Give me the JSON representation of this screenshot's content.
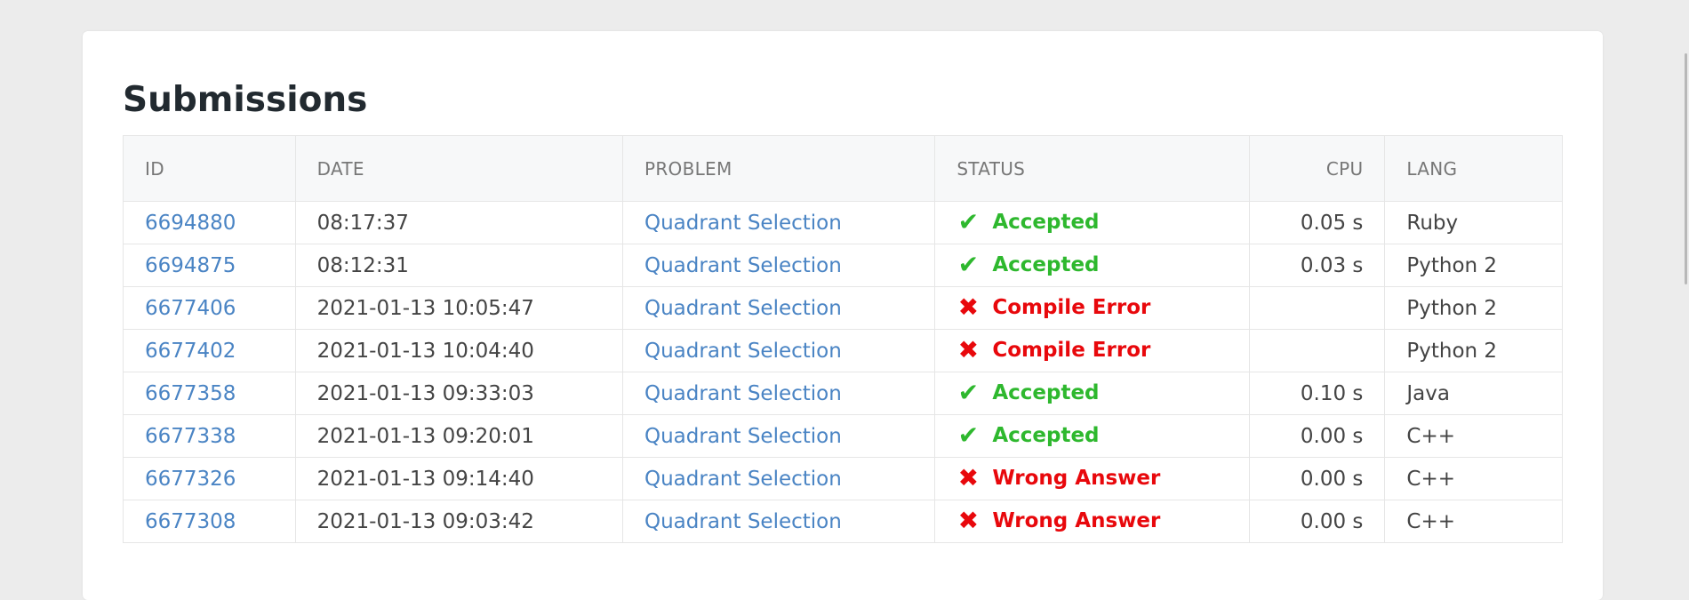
{
  "page": {
    "title": "Submissions"
  },
  "columns": {
    "id": "ID",
    "date": "DATE",
    "problem": "PROBLEM",
    "status": "STATUS",
    "cpu": "CPU",
    "lang": "LANG"
  },
  "colors": {
    "accepted": "#2eb82e",
    "error": "#e8080c",
    "link": "#4a84c4"
  },
  "icons": {
    "accepted": "check-icon",
    "error": "cross-icon"
  },
  "submissions": [
    {
      "id": "6694880",
      "date": "08:17:37",
      "problem": "Quadrant Selection",
      "status": "Accepted",
      "result": "accepted",
      "cpu": "0.05 s",
      "lang": "Ruby"
    },
    {
      "id": "6694875",
      "date": "08:12:31",
      "problem": "Quadrant Selection",
      "status": "Accepted",
      "result": "accepted",
      "cpu": "0.03 s",
      "lang": "Python 2"
    },
    {
      "id": "6677406",
      "date": "2021-01-13 10:05:47",
      "problem": "Quadrant Selection",
      "status": "Compile Error",
      "result": "error",
      "cpu": "",
      "lang": "Python 2"
    },
    {
      "id": "6677402",
      "date": "2021-01-13 10:04:40",
      "problem": "Quadrant Selection",
      "status": "Compile Error",
      "result": "error",
      "cpu": "",
      "lang": "Python 2"
    },
    {
      "id": "6677358",
      "date": "2021-01-13 09:33:03",
      "problem": "Quadrant Selection",
      "status": "Accepted",
      "result": "accepted",
      "cpu": "0.10 s",
      "lang": "Java"
    },
    {
      "id": "6677338",
      "date": "2021-01-13 09:20:01",
      "problem": "Quadrant Selection",
      "status": "Accepted",
      "result": "accepted",
      "cpu": "0.00 s",
      "lang": "C++"
    },
    {
      "id": "6677326",
      "date": "2021-01-13 09:14:40",
      "problem": "Quadrant Selection",
      "status": "Wrong Answer",
      "result": "error",
      "cpu": "0.00 s",
      "lang": "C++"
    },
    {
      "id": "6677308",
      "date": "2021-01-13 09:03:42",
      "problem": "Quadrant Selection",
      "status": "Wrong Answer",
      "result": "error",
      "cpu": "0.00 s",
      "lang": "C++"
    }
  ]
}
